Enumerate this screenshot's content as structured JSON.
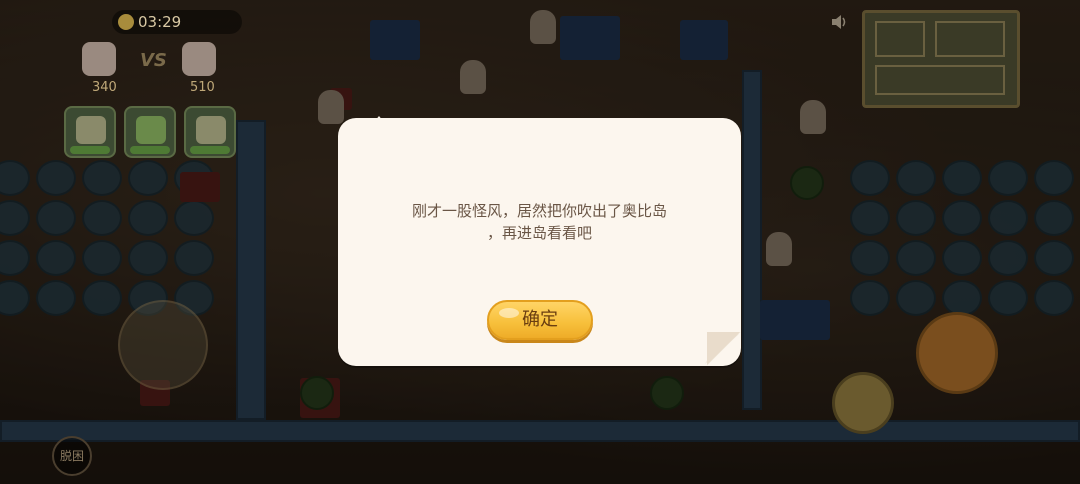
{
  "hud": {
    "timer": "03:29",
    "vs_label": "VS",
    "team_left_score": "340",
    "team_right_score": "510",
    "leave_button_label": "脱困"
  },
  "dialog": {
    "message_line1": "刚才一股怪风，居然把你吹出了奥比岛",
    "message_line2": "，再进岛看看吧",
    "confirm_label": "确定"
  },
  "colors": {
    "dialog_background": "#fcf6ee",
    "confirm_button": "#f7bf3a",
    "message_text": "#6a5646"
  }
}
